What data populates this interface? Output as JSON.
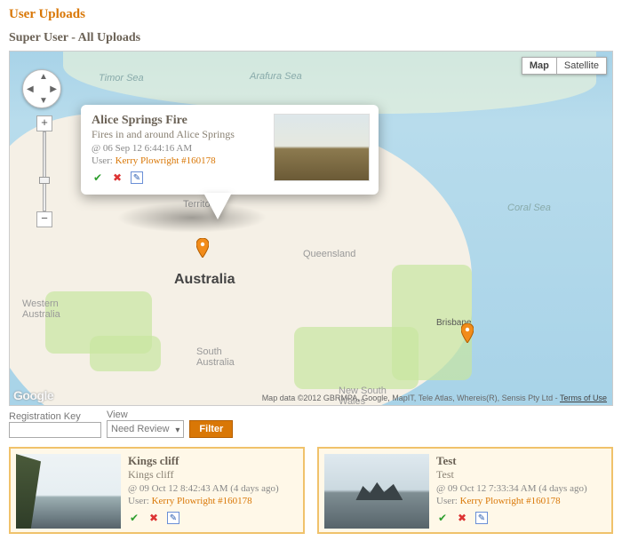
{
  "page": {
    "title": "User Uploads",
    "subtitle": "Super User - All Uploads"
  },
  "map": {
    "type_buttons": {
      "map": "Map",
      "satellite": "Satellite"
    },
    "labels": {
      "timor_sea": "Timor Sea",
      "arafura_sea": "Arafura Sea",
      "coral_sea": "Coral Sea",
      "nt": "Territory",
      "qld": "Queensland",
      "wa": "Western\nAustralia",
      "sa": "South\nAustralia",
      "nsw": "New South\nWales",
      "bne": "Brisbane",
      "country": "Australia"
    },
    "attribution": "Map data ©2012 GBRMPA, Google, MapIT, Tele Atlas, Whereis(R), Sensis Pty Ltd",
    "terms": "Terms of Use",
    "logo": "Google"
  },
  "infowin": {
    "title": "Alice Springs Fire",
    "desc": "Fires in and around Alice Springs",
    "timestamp": "@ 06 Sep 12 6:44:16 AM",
    "user_label": "User:",
    "user": "Kerry Plowright #160178"
  },
  "filter": {
    "regkey_label": "Registration Key",
    "view_label": "View",
    "view_value": "Need Review",
    "button": "Filter"
  },
  "cards": [
    {
      "title": "Kings cliff",
      "desc": "Kings cliff",
      "timestamp": "@ 09 Oct 12 8:42:43 AM (4 days ago)",
      "user_label": "User:",
      "user": "Kerry Plowright #160178"
    },
    {
      "title": "Test",
      "desc": "Test",
      "timestamp": "@ 09 Oct 12 7:33:34 AM (4 days ago)",
      "user_label": "User:",
      "user": "Kerry Plowright #160178"
    }
  ]
}
